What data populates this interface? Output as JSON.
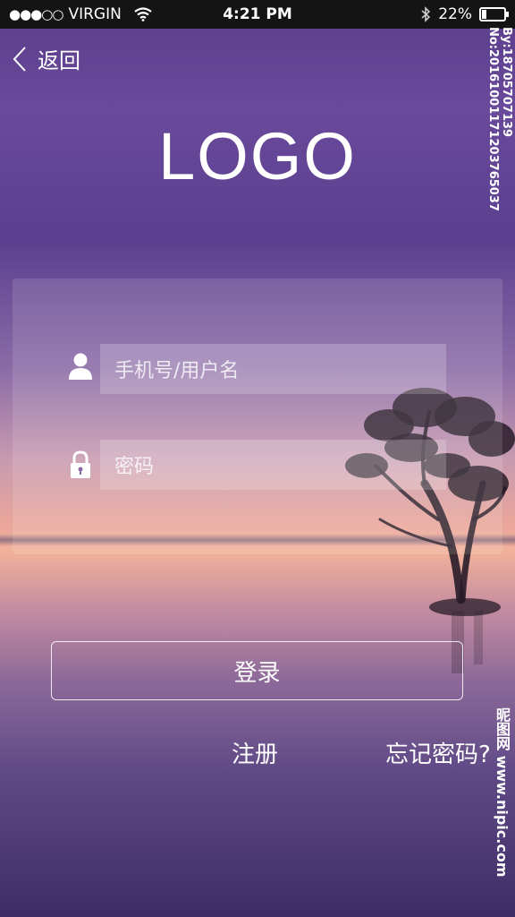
{
  "status_bar": {
    "signal": "●●●○○",
    "carrier": "VIRGIN",
    "time": "4:21 PM",
    "battery": "22%",
    "battery_level": 0.22
  },
  "nav": {
    "back_label": "返回"
  },
  "logo": "LOGO",
  "form": {
    "username_placeholder": "手机号/用户名",
    "password_placeholder": "密码"
  },
  "login_button": "登录",
  "links": {
    "register": "注册",
    "forgot": "忘记密码?"
  },
  "watermarks": {
    "side_text": "By:18705707139 No:20161001171203765037",
    "site": "昵图网 www.nipic.com"
  }
}
